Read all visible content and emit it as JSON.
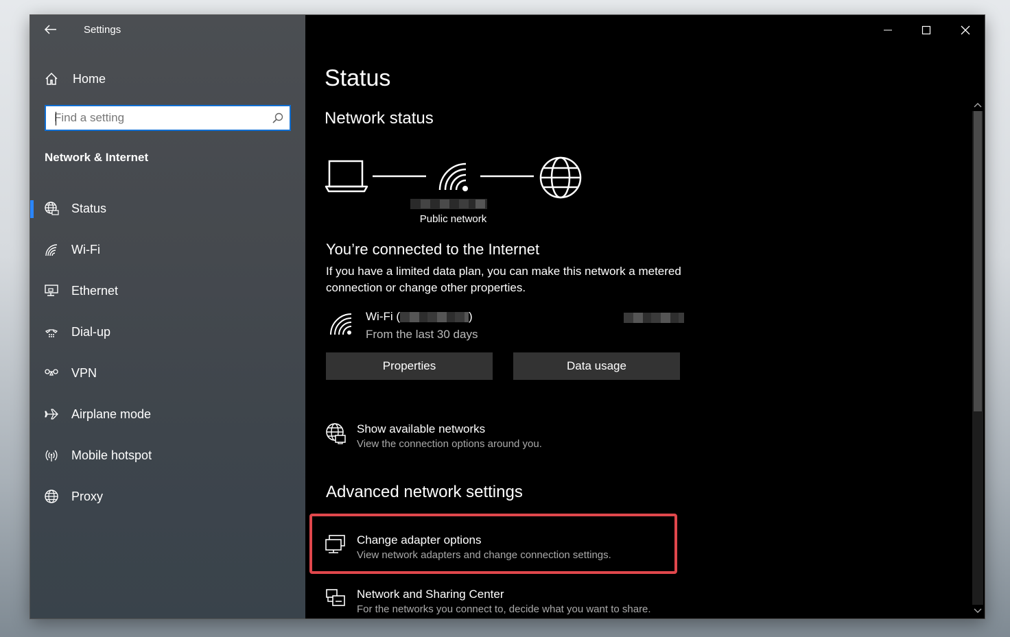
{
  "window": {
    "title": "Settings",
    "controls": {
      "minimize": "minimize",
      "maximize": "maximize",
      "close": "close"
    }
  },
  "sidebar": {
    "home_label": "Home",
    "search_placeholder": "Find a setting",
    "section_title": "Network & Internet",
    "items": [
      {
        "label": "Status",
        "icon": "globe-network-icon",
        "active": true
      },
      {
        "label": "Wi-Fi",
        "icon": "wifi-icon"
      },
      {
        "label": "Ethernet",
        "icon": "ethernet-icon"
      },
      {
        "label": "Dial-up",
        "icon": "dialup-icon"
      },
      {
        "label": "VPN",
        "icon": "vpn-icon"
      },
      {
        "label": "Airplane mode",
        "icon": "airplane-icon"
      },
      {
        "label": "Mobile hotspot",
        "icon": "hotspot-icon"
      },
      {
        "label": "Proxy",
        "icon": "globe-icon"
      }
    ]
  },
  "main": {
    "page_title": "Status",
    "network_status_heading": "Network status",
    "network_type": "Public network",
    "connected_heading": "You’re connected to the Internet",
    "connected_desc": "If you have a limited data plan, you can make this network a metered connection or change other properties.",
    "wifi": {
      "name_prefix": "Wi-Fi (",
      "name_suffix": ")",
      "subtitle": "From the last 30 days"
    },
    "buttons": {
      "properties": "Properties",
      "data_usage": "Data usage"
    },
    "show_networks": {
      "title": "Show available networks",
      "desc": "View the connection options around you."
    },
    "advanced_heading": "Advanced network settings",
    "adapter": {
      "title": "Change adapter options",
      "desc": "View network adapters and change connection settings."
    },
    "sharing": {
      "title": "Network and Sharing Center",
      "desc": "For the networks you connect to, decide what you want to share."
    }
  },
  "colors": {
    "accent": "#0f6ed3",
    "highlight": "#e0474c",
    "button_bg": "#333333"
  }
}
